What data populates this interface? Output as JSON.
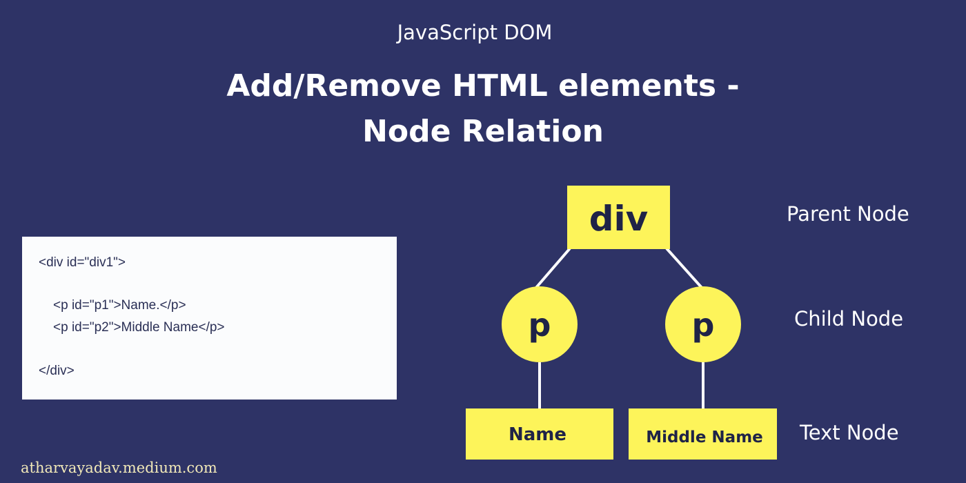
{
  "header": {
    "subtitle": "JavaScript DOM",
    "title_line1": "Add/Remove HTML elements -",
    "title_line2": "Node Relation"
  },
  "code": {
    "lines": [
      "<div id=\"div1\">",
      "<p id=\"p1\">Name.</p>",
      "<p id=\"p2\">Middle Name</p>",
      "</div>"
    ]
  },
  "tree": {
    "root": "div",
    "children": [
      "p",
      "p"
    ],
    "text_nodes": [
      "Name",
      "Middle Name"
    ]
  },
  "levels": {
    "parent": "Parent Node",
    "child": "Child Node",
    "text": "Text Node"
  },
  "footer": {
    "watermark": "atharvayadav.medium.com"
  },
  "colors": {
    "background": "#2e3366",
    "node_fill": "#fdf45a",
    "node_text": "#1f2347",
    "connector": "#ffffff",
    "code_background": "#fbfcfd"
  }
}
